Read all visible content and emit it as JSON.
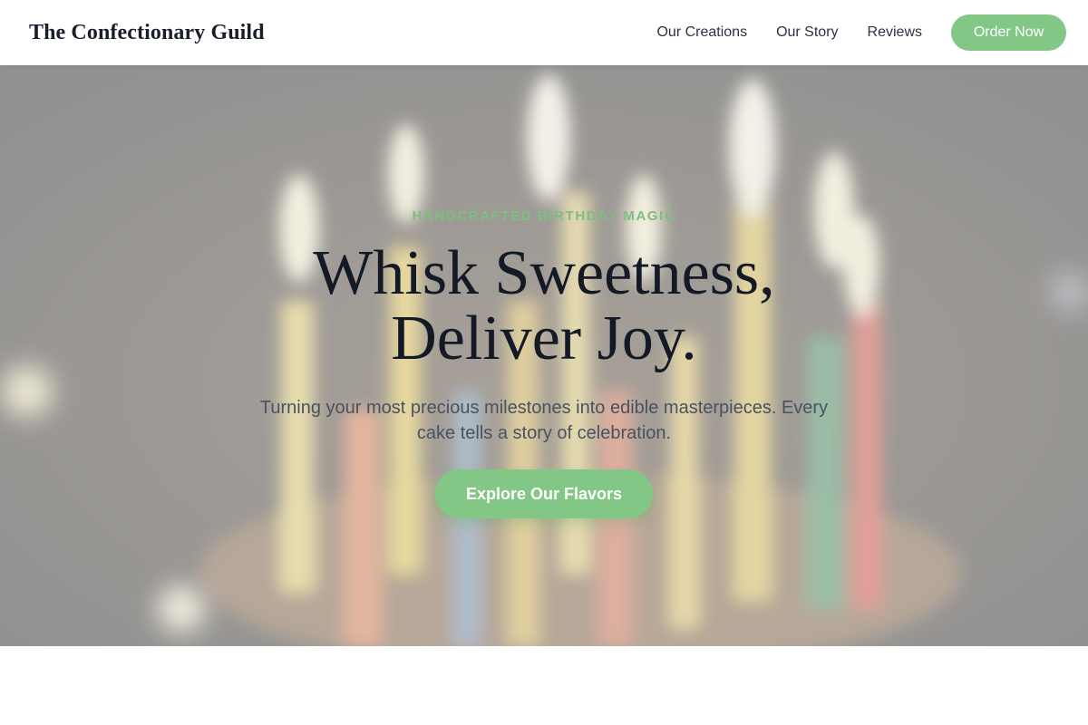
{
  "header": {
    "brand": "The Confectionary Guild",
    "nav": [
      "Our Creations",
      "Our Story",
      "Reviews"
    ],
    "order_label": "Order Now"
  },
  "hero": {
    "eyebrow": "HANDCRAFTED BIRTHDAY MAGIC",
    "headline_line1": "Whisk Sweetness,",
    "headline_line2": "Deliver Joy.",
    "subtext": "Turning your most precious milestones into edible masterpieces. Every cake tells a story of celebration.",
    "cta_label": "Explore Our Flavors",
    "background": "blurred-birthday-candles-photo"
  },
  "colors": {
    "accent": "#82c785",
    "heading": "#131a26",
    "body_text": "#4a5260",
    "eyebrow": "#7dbf7f"
  }
}
